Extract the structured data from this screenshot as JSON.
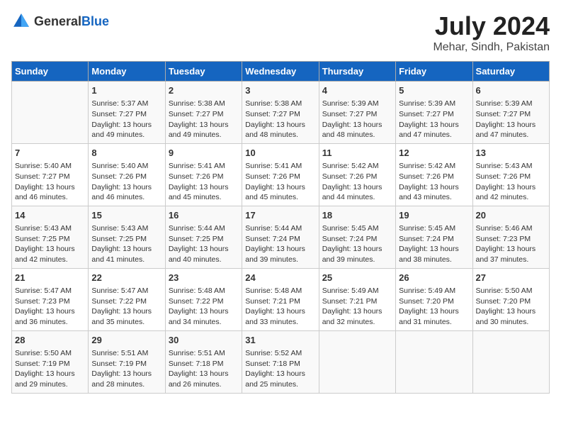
{
  "logo": {
    "general": "General",
    "blue": "Blue"
  },
  "title": "July 2024",
  "subtitle": "Mehar, Sindh, Pakistan",
  "days_header": [
    "Sunday",
    "Monday",
    "Tuesday",
    "Wednesday",
    "Thursday",
    "Friday",
    "Saturday"
  ],
  "weeks": [
    [
      {
        "day": "",
        "info": ""
      },
      {
        "day": "1",
        "info": "Sunrise: 5:37 AM\nSunset: 7:27 PM\nDaylight: 13 hours\nand 49 minutes."
      },
      {
        "day": "2",
        "info": "Sunrise: 5:38 AM\nSunset: 7:27 PM\nDaylight: 13 hours\nand 49 minutes."
      },
      {
        "day": "3",
        "info": "Sunrise: 5:38 AM\nSunset: 7:27 PM\nDaylight: 13 hours\nand 48 minutes."
      },
      {
        "day": "4",
        "info": "Sunrise: 5:39 AM\nSunset: 7:27 PM\nDaylight: 13 hours\nand 48 minutes."
      },
      {
        "day": "5",
        "info": "Sunrise: 5:39 AM\nSunset: 7:27 PM\nDaylight: 13 hours\nand 47 minutes."
      },
      {
        "day": "6",
        "info": "Sunrise: 5:39 AM\nSunset: 7:27 PM\nDaylight: 13 hours\nand 47 minutes."
      }
    ],
    [
      {
        "day": "7",
        "info": "Sunrise: 5:40 AM\nSunset: 7:27 PM\nDaylight: 13 hours\nand 46 minutes."
      },
      {
        "day": "8",
        "info": "Sunrise: 5:40 AM\nSunset: 7:26 PM\nDaylight: 13 hours\nand 46 minutes."
      },
      {
        "day": "9",
        "info": "Sunrise: 5:41 AM\nSunset: 7:26 PM\nDaylight: 13 hours\nand 45 minutes."
      },
      {
        "day": "10",
        "info": "Sunrise: 5:41 AM\nSunset: 7:26 PM\nDaylight: 13 hours\nand 45 minutes."
      },
      {
        "day": "11",
        "info": "Sunrise: 5:42 AM\nSunset: 7:26 PM\nDaylight: 13 hours\nand 44 minutes."
      },
      {
        "day": "12",
        "info": "Sunrise: 5:42 AM\nSunset: 7:26 PM\nDaylight: 13 hours\nand 43 minutes."
      },
      {
        "day": "13",
        "info": "Sunrise: 5:43 AM\nSunset: 7:26 PM\nDaylight: 13 hours\nand 42 minutes."
      }
    ],
    [
      {
        "day": "14",
        "info": "Sunrise: 5:43 AM\nSunset: 7:25 PM\nDaylight: 13 hours\nand 42 minutes."
      },
      {
        "day": "15",
        "info": "Sunrise: 5:43 AM\nSunset: 7:25 PM\nDaylight: 13 hours\nand 41 minutes."
      },
      {
        "day": "16",
        "info": "Sunrise: 5:44 AM\nSunset: 7:25 PM\nDaylight: 13 hours\nand 40 minutes."
      },
      {
        "day": "17",
        "info": "Sunrise: 5:44 AM\nSunset: 7:24 PM\nDaylight: 13 hours\nand 39 minutes."
      },
      {
        "day": "18",
        "info": "Sunrise: 5:45 AM\nSunset: 7:24 PM\nDaylight: 13 hours\nand 39 minutes."
      },
      {
        "day": "19",
        "info": "Sunrise: 5:45 AM\nSunset: 7:24 PM\nDaylight: 13 hours\nand 38 minutes."
      },
      {
        "day": "20",
        "info": "Sunrise: 5:46 AM\nSunset: 7:23 PM\nDaylight: 13 hours\nand 37 minutes."
      }
    ],
    [
      {
        "day": "21",
        "info": "Sunrise: 5:47 AM\nSunset: 7:23 PM\nDaylight: 13 hours\nand 36 minutes."
      },
      {
        "day": "22",
        "info": "Sunrise: 5:47 AM\nSunset: 7:22 PM\nDaylight: 13 hours\nand 35 minutes."
      },
      {
        "day": "23",
        "info": "Sunrise: 5:48 AM\nSunset: 7:22 PM\nDaylight: 13 hours\nand 34 minutes."
      },
      {
        "day": "24",
        "info": "Sunrise: 5:48 AM\nSunset: 7:21 PM\nDaylight: 13 hours\nand 33 minutes."
      },
      {
        "day": "25",
        "info": "Sunrise: 5:49 AM\nSunset: 7:21 PM\nDaylight: 13 hours\nand 32 minutes."
      },
      {
        "day": "26",
        "info": "Sunrise: 5:49 AM\nSunset: 7:20 PM\nDaylight: 13 hours\nand 31 minutes."
      },
      {
        "day": "27",
        "info": "Sunrise: 5:50 AM\nSunset: 7:20 PM\nDaylight: 13 hours\nand 30 minutes."
      }
    ],
    [
      {
        "day": "28",
        "info": "Sunrise: 5:50 AM\nSunset: 7:19 PM\nDaylight: 13 hours\nand 29 minutes."
      },
      {
        "day": "29",
        "info": "Sunrise: 5:51 AM\nSunset: 7:19 PM\nDaylight: 13 hours\nand 28 minutes."
      },
      {
        "day": "30",
        "info": "Sunrise: 5:51 AM\nSunset: 7:18 PM\nDaylight: 13 hours\nand 26 minutes."
      },
      {
        "day": "31",
        "info": "Sunrise: 5:52 AM\nSunset: 7:18 PM\nDaylight: 13 hours\nand 25 minutes."
      },
      {
        "day": "",
        "info": ""
      },
      {
        "day": "",
        "info": ""
      },
      {
        "day": "",
        "info": ""
      }
    ]
  ]
}
